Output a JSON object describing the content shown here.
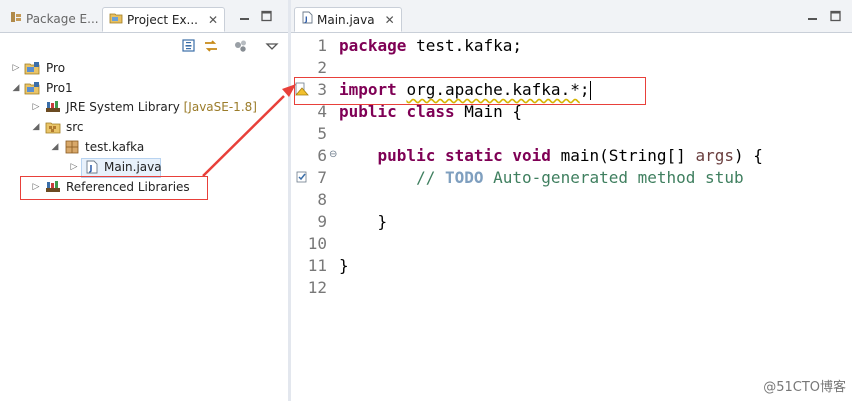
{
  "left_panel": {
    "tabs": [
      {
        "label": "Package E..."
      },
      {
        "label": "Project Ex..."
      }
    ],
    "close_glyph": "✕",
    "tree": {
      "items": [
        {
          "label": "Pro"
        },
        {
          "label": "Pro1"
        },
        {
          "label": "JRE System Library",
          "decoration": "[JavaSE-1.8]"
        },
        {
          "label": "src"
        },
        {
          "label": "test.kafka"
        },
        {
          "label": "Main.java"
        },
        {
          "label": "Referenced Libraries"
        }
      ]
    }
  },
  "editor": {
    "tab_label": "Main.java",
    "close_glyph": "✕",
    "line_numbers": [
      "1",
      "2",
      "3",
      "4",
      "5",
      "6",
      "7",
      "8",
      "9",
      "10",
      "11",
      "12"
    ],
    "fold_marker": "⊖",
    "code": {
      "l1_kw": "package",
      "l1_rest": " test.kafka;",
      "l3_kw": "import",
      "l3_pre": " ",
      "l3_flagged": "org.apache.kafka.*",
      "l3_end": ";",
      "l4_kw1": "public",
      "l4_kw2": "class",
      "l4_rest": " Main {",
      "l6_indent": "    ",
      "l6_kw1": "public",
      "l6_kw2": "static",
      "l6_kw3": "void",
      "l6_mid": " main(String[] ",
      "l6_param": "args",
      "l6_end": ") {",
      "l7_indent": "        ",
      "l7_comment_start": "// ",
      "l7_todo": "TODO",
      "l7_comment_rest": " Auto-generated method stub",
      "l9_text": "    }",
      "l11_text": "}"
    }
  },
  "watermark": "@51CTO博客",
  "colors": {
    "keyword": "#7f0055",
    "comment": "#3f7f5f",
    "todo": "#7f9fbf",
    "annotation_red": "#e8403a"
  }
}
